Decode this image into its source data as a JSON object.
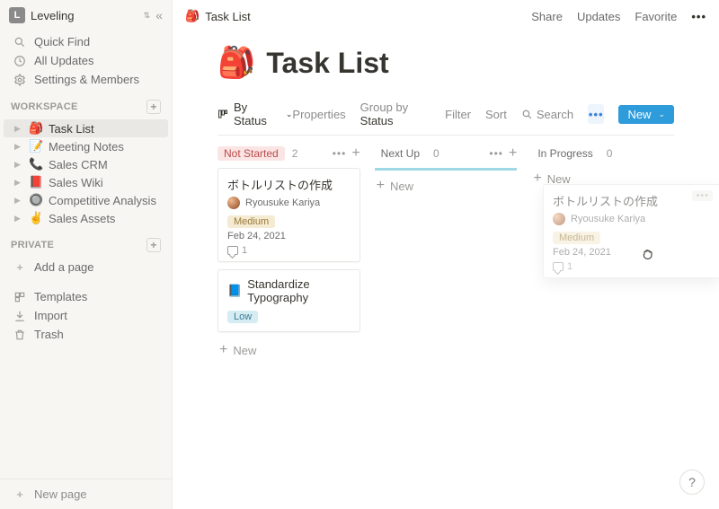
{
  "workspace": {
    "initial": "L",
    "name": "Leveling"
  },
  "sidebar": {
    "quick": [
      {
        "icon": "search",
        "label": "Quick Find"
      },
      {
        "icon": "clock",
        "label": "All Updates"
      },
      {
        "icon": "gear",
        "label": "Settings & Members"
      }
    ],
    "workspace_label": "WORKSPACE",
    "pages": [
      {
        "emoji": "🎒",
        "label": "Task List",
        "active": true
      },
      {
        "emoji": "📝",
        "label": "Meeting Notes"
      },
      {
        "emoji": "📞",
        "label": "Sales CRM"
      },
      {
        "emoji": "📕",
        "label": "Sales Wiki"
      },
      {
        "emoji": "🔘",
        "label": "Competitive Analysis"
      },
      {
        "emoji": "✌️",
        "label": "Sales Assets"
      }
    ],
    "private_label": "PRIVATE",
    "add_page_label": "Add a page",
    "tools": [
      {
        "icon": "templates",
        "label": "Templates"
      },
      {
        "icon": "import",
        "label": "Import"
      },
      {
        "icon": "trash",
        "label": "Trash"
      }
    ],
    "new_page_label": "New page"
  },
  "breadcrumb": {
    "emoji": "🎒",
    "text": "Task List"
  },
  "top_actions": {
    "share": "Share",
    "updates": "Updates",
    "favorite": "Favorite"
  },
  "page": {
    "emoji": "🎒",
    "title": "Task List"
  },
  "view": {
    "name": "By Status",
    "properties": "Properties",
    "group_by_prefix": "Group by ",
    "group_by_value": "Status",
    "filter": "Filter",
    "sort": "Sort",
    "search": "Search",
    "new": "New"
  },
  "board": {
    "columns": [
      {
        "title": "Not Started",
        "count": "2",
        "tagClass": "tag-notstarted",
        "bar": false
      },
      {
        "title": "Next Up",
        "count": "0",
        "tagClass": "tag-nextup",
        "bar": true
      },
      {
        "title": "In Progress",
        "count": "0",
        "tagClass": "tag-inprogress",
        "bar": false
      }
    ],
    "new_card": "New",
    "cards_col0": [
      {
        "title": "ボトルリストの作成",
        "assignee": "Ryousuke Kariya",
        "priority": "Medium",
        "priClass": "pri-medium",
        "date": "Feb 24, 2021",
        "comments": "1"
      },
      {
        "icon": "📘",
        "title": "Standardize Typography",
        "priority": "Low",
        "priClass": "pri-low"
      }
    ]
  },
  "ghost": {
    "title": "ボトルリストの作成",
    "assignee": "Ryousuke Kariya",
    "priority": "Medium",
    "date": "Feb 24, 2021",
    "comments": "1"
  },
  "help_label": "?"
}
